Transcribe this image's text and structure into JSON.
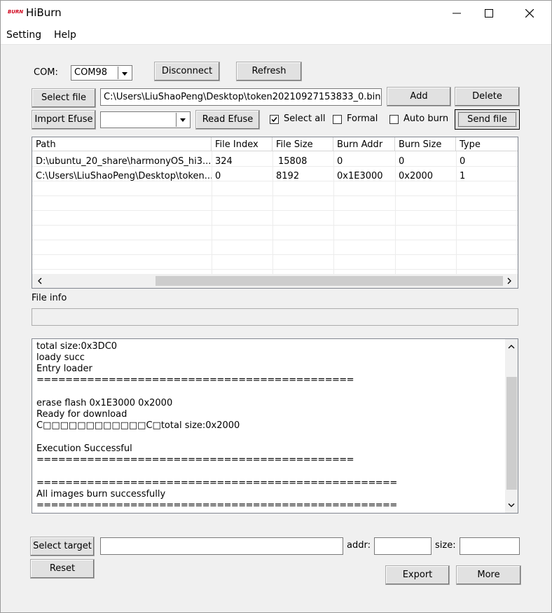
{
  "window": {
    "logo_text": "BURN",
    "title": "HiBurn"
  },
  "menu": [
    "Setting",
    "Help"
  ],
  "com": {
    "label": "COM:",
    "value": "COM98"
  },
  "buttons": {
    "disconnect": "Disconnect",
    "refresh": "Refresh",
    "select_file": "Select file",
    "add": "Add",
    "delete": "Delete",
    "import_efuse": "Import Efuse",
    "read_efuse": "Read Efuse",
    "send_file": "Send file",
    "select_target": "Select target",
    "reset": "Reset",
    "export": "Export",
    "more": "More"
  },
  "file_path": "C:\\Users\\LiuShaoPeng\\Desktop\\token20210927153833_0.bin",
  "efuse_value": "",
  "checkboxes": {
    "select_all": {
      "label": "Select all",
      "checked": true
    },
    "formal": {
      "label": "Formal",
      "checked": false
    },
    "auto_burn": {
      "label": "Auto burn",
      "checked": false
    }
  },
  "table": {
    "columns": [
      "Path",
      "File Index",
      "File Size",
      "Burn Addr",
      "Burn Size",
      "Type"
    ],
    "rows": [
      [
        "D:\\ubuntu_20_share\\harmonyOS_hi3...",
        "324",
        "15808",
        "0",
        "0",
        "0"
      ],
      [
        "C:\\Users\\LiuShaoPeng\\Desktop\\token...",
        "0",
        "8192",
        "0x1E3000",
        "0x2000",
        "1"
      ]
    ]
  },
  "file_info": {
    "label": "File info",
    "value": ""
  },
  "log_lines": [
    "total size:0x3DC0",
    "loady succ",
    "Entry loader",
    "============================================",
    "",
    "erase flash 0x1E3000 0x2000",
    "Ready for download",
    "C□□□□□□□□□□□□C□total size:0x2000",
    "",
    "Execution Successful",
    "============================================",
    "",
    "==================================================",
    "All images burn successfully",
    "=================================================="
  ],
  "target": {
    "value": "",
    "addr_label": "addr:",
    "addr_value": "",
    "size_label": "size:",
    "size_value": ""
  }
}
